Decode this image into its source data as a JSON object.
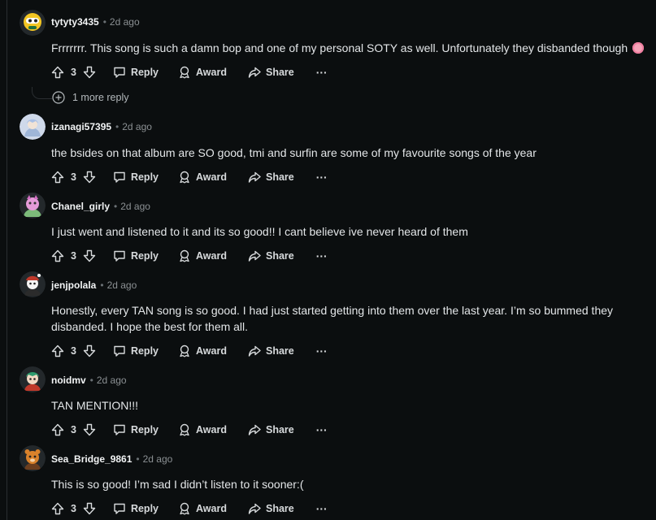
{
  "actions": {
    "reply": "Reply",
    "award": "Award",
    "share": "Share",
    "more": "···"
  },
  "comments": [
    {
      "username": "tytyty3435",
      "time": "2d ago",
      "text": "Frrrrrrr. This song is such a damn bop and one of my personal SOTY as well. Unfortunately they disbanded though",
      "votes": "3",
      "more_replies": "1 more reply",
      "avatar_color": "#f3c623"
    },
    {
      "username": "izanagi57395",
      "time": "2d ago",
      "text": "the bsides on that album are SO good, tmi and surfin are some of my favourite songs of the year",
      "votes": "3",
      "avatar_color": "#9fb6d8"
    },
    {
      "username": "Chanel_girly",
      "time": "2d ago",
      "text": "I just went and listened to it and its so good!! I cant believe ive never heard of them",
      "votes": "3",
      "avatar_color": "#e59bd8"
    },
    {
      "username": "jenjpolala",
      "time": "2d ago",
      "text": "Honestly, every TAN song is so good. I had just started getting into them over the last year. I’m so bummed they disbanded. I hope the best for them all.",
      "votes": "3",
      "avatar_color": "#c0392b"
    },
    {
      "username": "noidmv",
      "time": "2d ago",
      "text": "TAN MENTION!!!",
      "votes": "3",
      "avatar_color": "#2e9b6e"
    },
    {
      "username": "Sea_Bridge_9861",
      "time": "2d ago",
      "text": "This is so good! I’m sad I didn’t listen to it sooner:(",
      "votes": "3",
      "avatar_color": "#d9822b"
    }
  ]
}
